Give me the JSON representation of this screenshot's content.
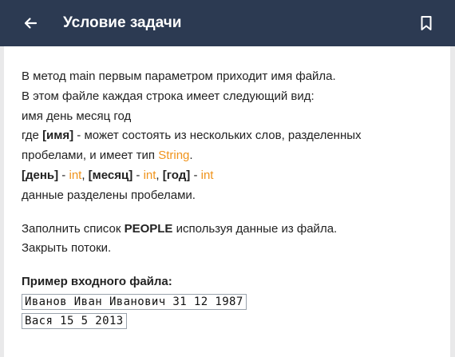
{
  "header": {
    "back_icon": "arrow-left-icon",
    "title": "Условие задачи",
    "bookmark_icon": "bookmark-icon",
    "background": "#2c3a52"
  },
  "task": {
    "line1": "В метод main первым параметром приходит имя файла.",
    "line2": "В этом файле каждая строка имеет следующий вид:",
    "line3": "имя день месяц год",
    "line4_pre": "где ",
    "line4_bold": "[имя]",
    "line4_post": " - может состоять из нескольких слов, разделенных",
    "line5_pre": "пробелами, и имеет тип ",
    "line5_type": "String",
    "line5_post": ".",
    "line6_day": "[день]",
    "line6_sep1": " - ",
    "line6_int1": "int",
    "line6_comma1": ", ",
    "line6_month": "[месяц]",
    "line6_sep2": " - ",
    "line6_int2": "int",
    "line6_comma2": ", ",
    "line6_year": "[год]",
    "line6_sep3": " - ",
    "line6_int3": "int",
    "line7": "данные разделены пробелами.",
    "line8_pre": "Заполнить список ",
    "line8_bold": "PEOPLE",
    "line8_post": " используя данные из файла.",
    "line9": "Закрыть потоки.",
    "example_heading": "Пример входного файла:",
    "example_lines": [
      "Иванов Иван Иванович 31 12 1987",
      "Вася 15 5 2013"
    ],
    "accent_color": "#f0931b"
  }
}
